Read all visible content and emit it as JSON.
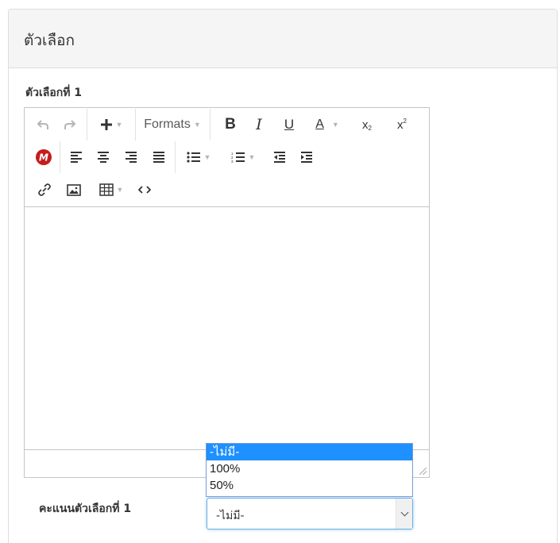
{
  "panel": {
    "title": "ตัวเลือก"
  },
  "choice": {
    "label": "ตัวเลือกที่ 1",
    "grade_label": "คะแนนตัวเลือกที่ 1"
  },
  "toolbar": {
    "formats_label": "Formats",
    "bold": "B",
    "italic": "I",
    "underline": "U",
    "text_color": "A",
    "subscript": "x",
    "superscript": "x"
  },
  "grade_select": {
    "selected": "-ไม่มี-",
    "options": [
      "-ไม่มี-",
      "100%",
      "50%"
    ]
  },
  "colors": {
    "accent": "#1e90ff",
    "focus_border": "#66afe9",
    "heading_bg": "#f5f5f5",
    "mathtype_red": "#c41d1d"
  }
}
